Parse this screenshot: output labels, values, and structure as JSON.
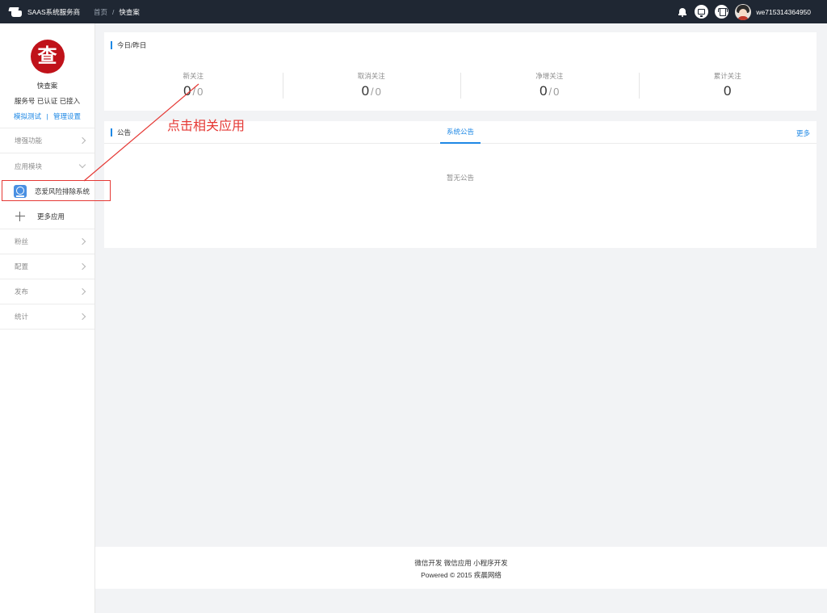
{
  "header": {
    "brand": "SAAS系统服务商",
    "breadcrumb": {
      "home": "首页",
      "separator": "/",
      "current": "快查案"
    },
    "username": "we715314364950",
    "icons": [
      "bell-icon",
      "monitor-icon",
      "shirt-icon",
      "avatar"
    ]
  },
  "sidebar": {
    "account": {
      "logo_char": "查",
      "name": "快查案",
      "status": "服务号 已认证 已接入",
      "link_test": "模拟测试",
      "link_divider": "|",
      "link_manage": "管理设置"
    },
    "nav": {
      "enhance": "增强功能",
      "modules": "应用模块",
      "app_item": "恋爱风险排除系统",
      "more_apps": "更多应用",
      "fans": "粉丝",
      "config": "配置",
      "publish": "发布",
      "stats": "统计"
    }
  },
  "stats_card": {
    "title": "今日/昨日",
    "items": [
      {
        "label": "新关注",
        "today": "0",
        "slash": "/",
        "yesterday": "0"
      },
      {
        "label": "取消关注",
        "today": "0",
        "slash": "/",
        "yesterday": "0"
      },
      {
        "label": "净增关注",
        "today": "0",
        "slash": "/",
        "yesterday": "0"
      },
      {
        "label": "累计关注",
        "today": "0"
      }
    ]
  },
  "notice_card": {
    "title": "公告",
    "tab": "系统公告",
    "more": "更多",
    "empty": "暂无公告"
  },
  "footer": {
    "links": "微信开发 微信应用 小程序开发",
    "copyright": "Powered © 2015 疾晨网络"
  },
  "annotation": {
    "text": "点击相关应用",
    "color": "#e53935"
  },
  "colors": {
    "accent": "#1e88e5",
    "header_bg": "#1f2733",
    "logo_red": "#c0121a"
  }
}
